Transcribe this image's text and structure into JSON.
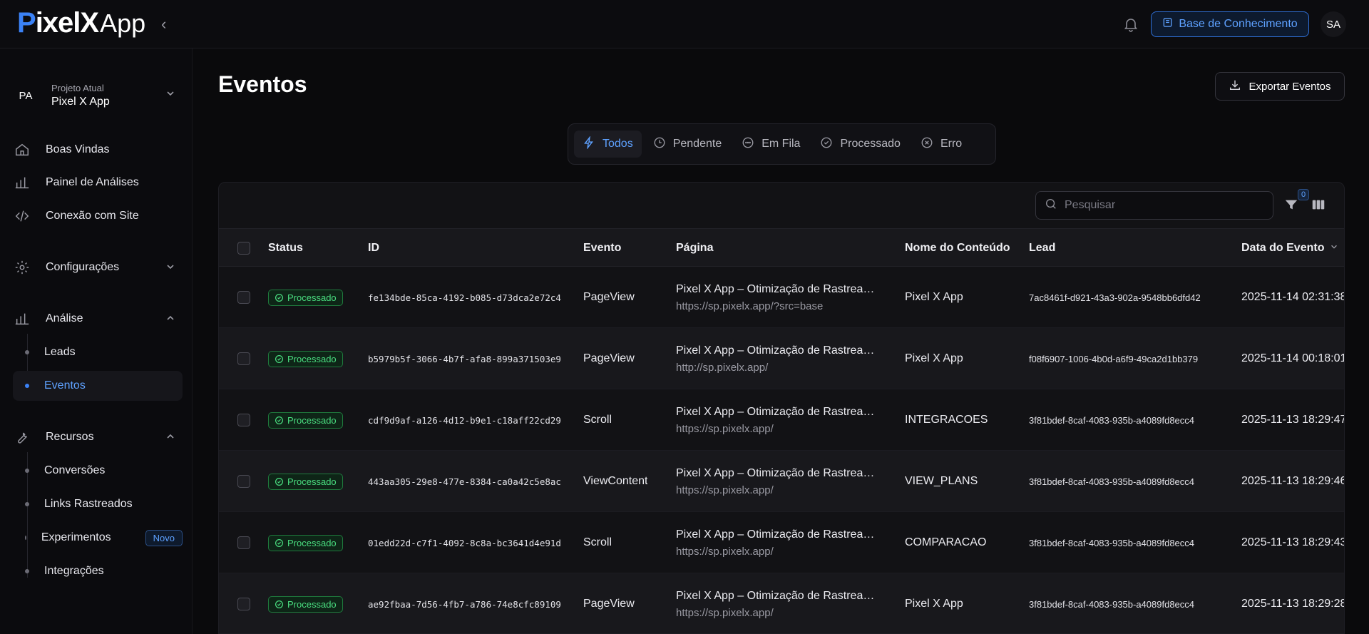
{
  "brand": {
    "logo_main": "ixelX",
    "logo_p": "P",
    "logo_app": "App"
  },
  "topbar": {
    "collapse_icon": "‹",
    "knowledge_base": "Base de Conhecimento",
    "avatar": "SA"
  },
  "project": {
    "initials": "PA",
    "label": "Projeto Atual",
    "name": "Pixel X App"
  },
  "nav": {
    "welcome": "Boas Vindas",
    "analytics_panel": "Painel de Análises",
    "site_connection": "Conexão com Site",
    "settings": "Configurações",
    "analysis": "Análise",
    "leads": "Leads",
    "events": "Eventos",
    "resources": "Recursos",
    "conversions": "Conversões",
    "tracked_links": "Links Rastreados",
    "experiments": "Experimentos",
    "experiments_badge": "Novo",
    "integrations": "Integrações"
  },
  "page": {
    "title": "Eventos",
    "export_label": "Exportar Eventos"
  },
  "filters": [
    {
      "label": "Todos",
      "icon": "lightning-icon",
      "active": true
    },
    {
      "label": "Pendente",
      "icon": "clock-icon",
      "active": false
    },
    {
      "label": "Em Fila",
      "icon": "dots-circle-icon",
      "active": false
    },
    {
      "label": "Processado",
      "icon": "check-circle-icon",
      "active": false
    },
    {
      "label": "Erro",
      "icon": "x-circle-icon",
      "active": false
    }
  ],
  "table": {
    "search_placeholder": "Pesquisar",
    "filter_count": "0",
    "headers": {
      "status": "Status",
      "id": "ID",
      "event": "Evento",
      "page": "Página",
      "content": "Nome do Conteúdo",
      "lead": "Lead",
      "date": "Data do Evento"
    },
    "rows": [
      {
        "status": "Processado",
        "id": "fe134bde-85ca-4192-b085-d73dca2e72c4",
        "event": "PageView",
        "page_title": "Pixel X App – Otimização de Rastreamento",
        "page_url": "https://sp.pixelx.app/?src=base",
        "content": "Pixel X App",
        "lead": "7ac8461f-d921-43a3-902a-9548bb6dfd42",
        "date": "2025-11-14 02:31:38"
      },
      {
        "status": "Processado",
        "id": "b5979b5f-3066-4b7f-afa8-899a371503e9",
        "event": "PageView",
        "page_title": "Pixel X App – Otimização de Rastreamento",
        "page_url": "http://sp.pixelx.app/",
        "content": "Pixel X App",
        "lead": "f08f6907-1006-4b0d-a6f9-49ca2d1bb379",
        "date": "2025-11-14 00:18:01"
      },
      {
        "status": "Processado",
        "id": "cdf9d9af-a126-4d12-b9e1-c18aff22cd29",
        "event": "Scroll",
        "page_title": "Pixel X App – Otimização de Rastreamento",
        "page_url": "https://sp.pixelx.app/",
        "content": "INTEGRACOES",
        "lead": "3f81bdef-8caf-4083-935b-a4089fd8ecc4",
        "date": "2025-11-13 18:29:47"
      },
      {
        "status": "Processado",
        "id": "443aa305-29e8-477e-8384-ca0a42c5e8ac",
        "event": "ViewContent",
        "page_title": "Pixel X App – Otimização de Rastreamento",
        "page_url": "https://sp.pixelx.app/",
        "content": "VIEW_PLANS",
        "lead": "3f81bdef-8caf-4083-935b-a4089fd8ecc4",
        "date": "2025-11-13 18:29:46"
      },
      {
        "status": "Processado",
        "id": "01edd22d-c7f1-4092-8c8a-bc3641d4e91d",
        "event": "Scroll",
        "page_title": "Pixel X App – Otimização de Rastreamento",
        "page_url": "https://sp.pixelx.app/",
        "content": "COMPARACAO",
        "lead": "3f81bdef-8caf-4083-935b-a4089fd8ecc4",
        "date": "2025-11-13 18:29:43"
      },
      {
        "status": "Processado",
        "id": "ae92fbaa-7d56-4fb7-a786-74e8cfc89109",
        "event": "PageView",
        "page_title": "Pixel X App – Otimização de Rastreamento",
        "page_url": "https://sp.pixelx.app/",
        "content": "Pixel X App",
        "lead": "3f81bdef-8caf-4083-935b-a4089fd8ecc4",
        "date": "2025-11-13 18:29:28"
      }
    ]
  },
  "colors": {
    "accent": "#3b82f6",
    "success": "#4ade80",
    "background": "#0a0a0c"
  }
}
